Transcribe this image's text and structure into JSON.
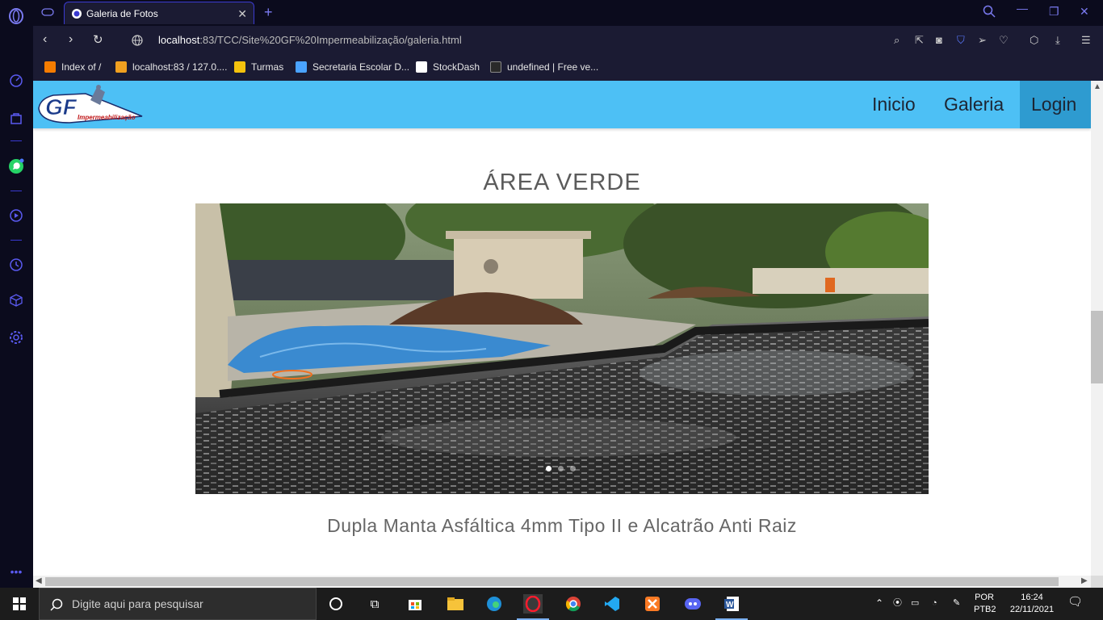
{
  "browser": {
    "tab_title": "Galeria de Fotos",
    "url_host": "localhost",
    "url_rest": ":83/TCC/Site%20GF%20Impermeabilização/galeria.html",
    "bookmarks": [
      {
        "label": "Index of /",
        "icon": "xampp-icon",
        "color": "#f57c00"
      },
      {
        "label": "localhost:83 / 127.0....",
        "icon": "phpmyadmin-icon",
        "color": "#f0a020"
      },
      {
        "label": "Turmas",
        "icon": "classroom-icon",
        "color": "#f4c20d"
      },
      {
        "label": "Secretaria Escolar D...",
        "icon": "secretaria-icon",
        "color": "#4aa3ff"
      },
      {
        "label": "StockDash",
        "icon": "page-icon",
        "color": "#ffffff"
      },
      {
        "label": "undefined | Free ve...",
        "icon": "s-logo-icon",
        "color": "#2a2a2a"
      }
    ]
  },
  "site": {
    "logo_text": "GF",
    "logo_sub": "Impermeabilização",
    "nav": [
      {
        "label": "Inicio",
        "active": false
      },
      {
        "label": "Galeria",
        "active": false
      },
      {
        "label": "Login",
        "active": true
      }
    ],
    "section_title": "ÁREA VERDE",
    "caption": "Dupla Manta Asfáltica 4mm Tipo II e Alcatrão Anti Raiz",
    "carousel_slides": 3,
    "carousel_active": 1
  },
  "taskbar": {
    "search_placeholder": "Digite aqui para pesquisar",
    "lang_top": "POR",
    "lang_bottom": "PTB2",
    "time": "16:24",
    "date": "22/11/2021"
  },
  "colors": {
    "navbar": "#4dc0f5",
    "navbar_active": "#2e9bd0",
    "opera_accent": "#3a3ad0"
  }
}
